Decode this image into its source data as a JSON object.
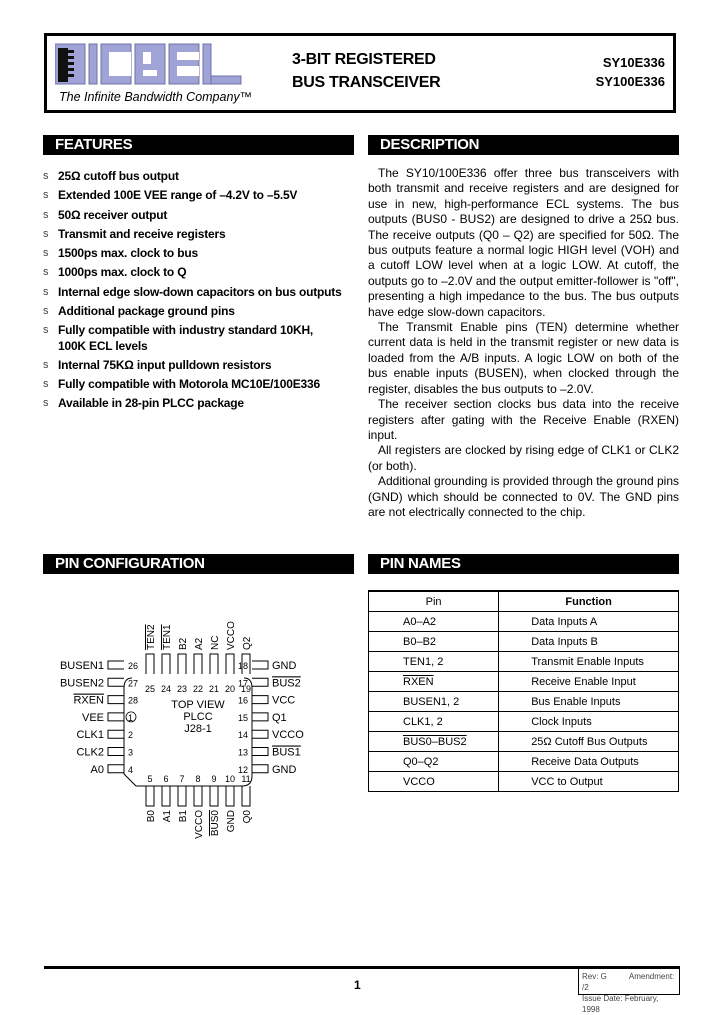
{
  "header": {
    "logo_text": "MICREL",
    "tagline": "The Infinite Bandwidth Company™",
    "title_line1": "3-BIT REGISTERED",
    "title_line2": "BUS TRANSCEIVER",
    "part_numbers": [
      "SY10E336",
      "SY100E336"
    ],
    "logo_color": "#9fa3d6"
  },
  "features": {
    "heading": "FEATURES",
    "bullet": "s",
    "items": [
      "25Ω cutoff bus output",
      "Extended 100E VEE range of –4.2V to –5.5V",
      "50Ω receiver output",
      "Transmit and receive registers",
      "1500ps max. clock to bus",
      "1000ps max. clock to Q",
      "Internal edge slow-down capacitors on bus outputs",
      "Additional package ground pins",
      "Fully compatible with industry standard 10KH,",
      "Internal 75KΩ input pulldown resistors",
      "Fully compatible with Motorola MC10E/100E336",
      "Available in 28-pin PLCC package"
    ],
    "item9_continuation": "100K ECL levels"
  },
  "description": {
    "heading": "DESCRIPTION",
    "paragraphs": [
      "The SY10/100E336 offer three bus transceivers with both transmit and receive registers and are designed for use in new, high-performance ECL systems. The bus outputs (BUS0 - BUS2) are designed to drive a 25Ω bus. The receive outputs (Q0 – Q2) are specified for 50Ω. The bus outputs feature a normal logic HIGH level (VOH) and a cutoff LOW level when at a logic LOW. At cutoff, the outputs go to –2.0V and the output emitter-follower is \"off\", presenting a high impedance to the bus. The bus outputs have edge slow-down capacitors.",
      "The Transmit Enable pins (TEN) determine whether current data is held in the transmit register or new data is loaded from the A/B inputs. A logic LOW on both of the bus enable inputs (BUSEN), when clocked through the register, disables the bus outputs to –2.0V.",
      "The receiver section clocks bus data into the receive registers after gating with the Receive Enable (RXEN) input.",
      "All registers are clocked by rising edge of CLK1 or CLK2 (or both).",
      "Additional grounding is provided through the ground pins (GND) which should be connected to 0V. The GND pins are not electrically connected to the chip."
    ]
  },
  "pin_config": {
    "heading": "PIN CONFIGURATION",
    "center_label": [
      "TOP VIEW",
      "PLCC",
      "J28-1"
    ],
    "top_pins": [
      {
        "num": "25",
        "name": "TEN2",
        "overline": true
      },
      {
        "num": "24",
        "name": "TEN1",
        "overline": true
      },
      {
        "num": "23",
        "name": "B2",
        "overline": false
      },
      {
        "num": "22",
        "name": "A2",
        "overline": false
      },
      {
        "num": "21",
        "name": "NC",
        "overline": false
      },
      {
        "num": "20",
        "name": "VCCO",
        "overline": false
      },
      {
        "num": "19",
        "name": "Q2",
        "overline": false
      }
    ],
    "left_pins": [
      {
        "num": "26",
        "name": "BUSEN1",
        "overline": false
      },
      {
        "num": "27",
        "name": "BUSEN2",
        "overline": false
      },
      {
        "num": "28",
        "name": "RXEN",
        "overline": true
      },
      {
        "num": "1",
        "name": "VEE",
        "overline": false
      },
      {
        "num": "2",
        "name": "CLK1",
        "overline": false
      },
      {
        "num": "3",
        "name": "CLK2",
        "overline": false
      },
      {
        "num": "4",
        "name": "A0",
        "overline": false
      }
    ],
    "right_pins": [
      {
        "num": "18",
        "name": "GND",
        "overline": false
      },
      {
        "num": "17",
        "name": "BUS2",
        "overline": true
      },
      {
        "num": "16",
        "name": "VCC",
        "overline": false
      },
      {
        "num": "15",
        "name": "Q1",
        "overline": false
      },
      {
        "num": "14",
        "name": "VCCO",
        "overline": false
      },
      {
        "num": "13",
        "name": "BUS1",
        "overline": true
      },
      {
        "num": "12",
        "name": "GND",
        "overline": false
      }
    ],
    "bottom_pins": [
      {
        "num": "5",
        "name": "B0",
        "overline": false
      },
      {
        "num": "6",
        "name": "A1",
        "overline": false
      },
      {
        "num": "7",
        "name": "B1",
        "overline": false
      },
      {
        "num": "8",
        "name": "VCCO",
        "overline": false
      },
      {
        "num": "9",
        "name": "BUS0",
        "overline": true
      },
      {
        "num": "10",
        "name": "GND",
        "overline": false
      },
      {
        "num": "11",
        "name": "Q0",
        "overline": false
      }
    ]
  },
  "pin_names": {
    "heading": "PIN NAMES",
    "columns": [
      "Pin",
      "Function"
    ],
    "rows": [
      {
        "pin": "A0–A2",
        "function": "Data Inputs A",
        "overline": false
      },
      {
        "pin": "B0–B2",
        "function": "Data Inputs B",
        "overline": false
      },
      {
        "pin": "TEN1, 2",
        "function": "Transmit Enable Inputs",
        "overline": false
      },
      {
        "pin": "RXEN",
        "function": "Receive Enable Input",
        "overline": true
      },
      {
        "pin": "BUSEN1, 2",
        "function": "Bus Enable Inputs",
        "overline": false
      },
      {
        "pin": "CLK1, 2",
        "function": "Clock Inputs",
        "overline": false
      },
      {
        "pin": "BUS0–BUS2",
        "function": "25Ω Cutoff Bus Outputs",
        "overline": true
      },
      {
        "pin": "Q0–Q2",
        "function": "Receive Data Outputs",
        "overline": false
      },
      {
        "pin": "VCCO",
        "function": "VCC to Output",
        "overline": false
      }
    ]
  },
  "footer": {
    "page_number": "1",
    "rev": "Rev: G",
    "amendment": "Amendment: /2",
    "issue_date": "Issue Date: February, 1998"
  }
}
